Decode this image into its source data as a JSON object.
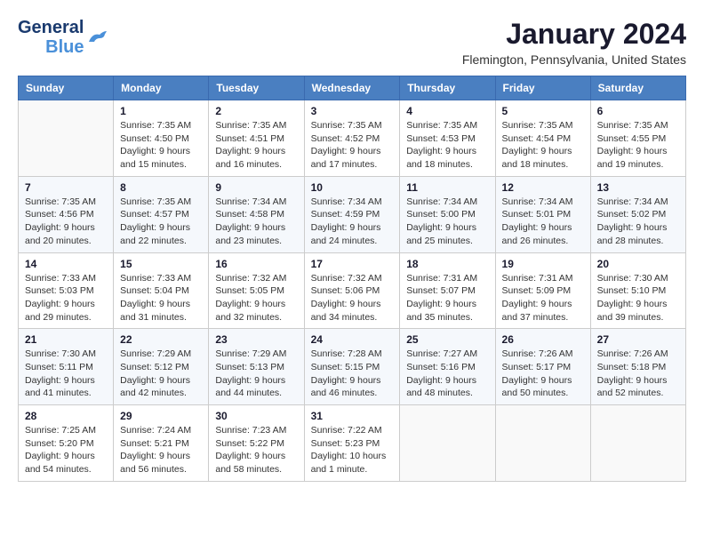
{
  "header": {
    "logo_general": "General",
    "logo_blue": "Blue",
    "month_title": "January 2024",
    "location": "Flemington, Pennsylvania, United States"
  },
  "calendar": {
    "days_of_week": [
      "Sunday",
      "Monday",
      "Tuesday",
      "Wednesday",
      "Thursday",
      "Friday",
      "Saturday"
    ],
    "weeks": [
      [
        {
          "day": "",
          "info": ""
        },
        {
          "day": "1",
          "info": "Sunrise: 7:35 AM\nSunset: 4:50 PM\nDaylight: 9 hours\nand 15 minutes."
        },
        {
          "day": "2",
          "info": "Sunrise: 7:35 AM\nSunset: 4:51 PM\nDaylight: 9 hours\nand 16 minutes."
        },
        {
          "day": "3",
          "info": "Sunrise: 7:35 AM\nSunset: 4:52 PM\nDaylight: 9 hours\nand 17 minutes."
        },
        {
          "day": "4",
          "info": "Sunrise: 7:35 AM\nSunset: 4:53 PM\nDaylight: 9 hours\nand 18 minutes."
        },
        {
          "day": "5",
          "info": "Sunrise: 7:35 AM\nSunset: 4:54 PM\nDaylight: 9 hours\nand 18 minutes."
        },
        {
          "day": "6",
          "info": "Sunrise: 7:35 AM\nSunset: 4:55 PM\nDaylight: 9 hours\nand 19 minutes."
        }
      ],
      [
        {
          "day": "7",
          "info": "Sunrise: 7:35 AM\nSunset: 4:56 PM\nDaylight: 9 hours\nand 20 minutes."
        },
        {
          "day": "8",
          "info": "Sunrise: 7:35 AM\nSunset: 4:57 PM\nDaylight: 9 hours\nand 22 minutes."
        },
        {
          "day": "9",
          "info": "Sunrise: 7:34 AM\nSunset: 4:58 PM\nDaylight: 9 hours\nand 23 minutes."
        },
        {
          "day": "10",
          "info": "Sunrise: 7:34 AM\nSunset: 4:59 PM\nDaylight: 9 hours\nand 24 minutes."
        },
        {
          "day": "11",
          "info": "Sunrise: 7:34 AM\nSunset: 5:00 PM\nDaylight: 9 hours\nand 25 minutes."
        },
        {
          "day": "12",
          "info": "Sunrise: 7:34 AM\nSunset: 5:01 PM\nDaylight: 9 hours\nand 26 minutes."
        },
        {
          "day": "13",
          "info": "Sunrise: 7:34 AM\nSunset: 5:02 PM\nDaylight: 9 hours\nand 28 minutes."
        }
      ],
      [
        {
          "day": "14",
          "info": "Sunrise: 7:33 AM\nSunset: 5:03 PM\nDaylight: 9 hours\nand 29 minutes."
        },
        {
          "day": "15",
          "info": "Sunrise: 7:33 AM\nSunset: 5:04 PM\nDaylight: 9 hours\nand 31 minutes."
        },
        {
          "day": "16",
          "info": "Sunrise: 7:32 AM\nSunset: 5:05 PM\nDaylight: 9 hours\nand 32 minutes."
        },
        {
          "day": "17",
          "info": "Sunrise: 7:32 AM\nSunset: 5:06 PM\nDaylight: 9 hours\nand 34 minutes."
        },
        {
          "day": "18",
          "info": "Sunrise: 7:31 AM\nSunset: 5:07 PM\nDaylight: 9 hours\nand 35 minutes."
        },
        {
          "day": "19",
          "info": "Sunrise: 7:31 AM\nSunset: 5:09 PM\nDaylight: 9 hours\nand 37 minutes."
        },
        {
          "day": "20",
          "info": "Sunrise: 7:30 AM\nSunset: 5:10 PM\nDaylight: 9 hours\nand 39 minutes."
        }
      ],
      [
        {
          "day": "21",
          "info": "Sunrise: 7:30 AM\nSunset: 5:11 PM\nDaylight: 9 hours\nand 41 minutes."
        },
        {
          "day": "22",
          "info": "Sunrise: 7:29 AM\nSunset: 5:12 PM\nDaylight: 9 hours\nand 42 minutes."
        },
        {
          "day": "23",
          "info": "Sunrise: 7:29 AM\nSunset: 5:13 PM\nDaylight: 9 hours\nand 44 minutes."
        },
        {
          "day": "24",
          "info": "Sunrise: 7:28 AM\nSunset: 5:15 PM\nDaylight: 9 hours\nand 46 minutes."
        },
        {
          "day": "25",
          "info": "Sunrise: 7:27 AM\nSunset: 5:16 PM\nDaylight: 9 hours\nand 48 minutes."
        },
        {
          "day": "26",
          "info": "Sunrise: 7:26 AM\nSunset: 5:17 PM\nDaylight: 9 hours\nand 50 minutes."
        },
        {
          "day": "27",
          "info": "Sunrise: 7:26 AM\nSunset: 5:18 PM\nDaylight: 9 hours\nand 52 minutes."
        }
      ],
      [
        {
          "day": "28",
          "info": "Sunrise: 7:25 AM\nSunset: 5:20 PM\nDaylight: 9 hours\nand 54 minutes."
        },
        {
          "day": "29",
          "info": "Sunrise: 7:24 AM\nSunset: 5:21 PM\nDaylight: 9 hours\nand 56 minutes."
        },
        {
          "day": "30",
          "info": "Sunrise: 7:23 AM\nSunset: 5:22 PM\nDaylight: 9 hours\nand 58 minutes."
        },
        {
          "day": "31",
          "info": "Sunrise: 7:22 AM\nSunset: 5:23 PM\nDaylight: 10 hours\nand 1 minute."
        },
        {
          "day": "",
          "info": ""
        },
        {
          "day": "",
          "info": ""
        },
        {
          "day": "",
          "info": ""
        }
      ]
    ]
  }
}
